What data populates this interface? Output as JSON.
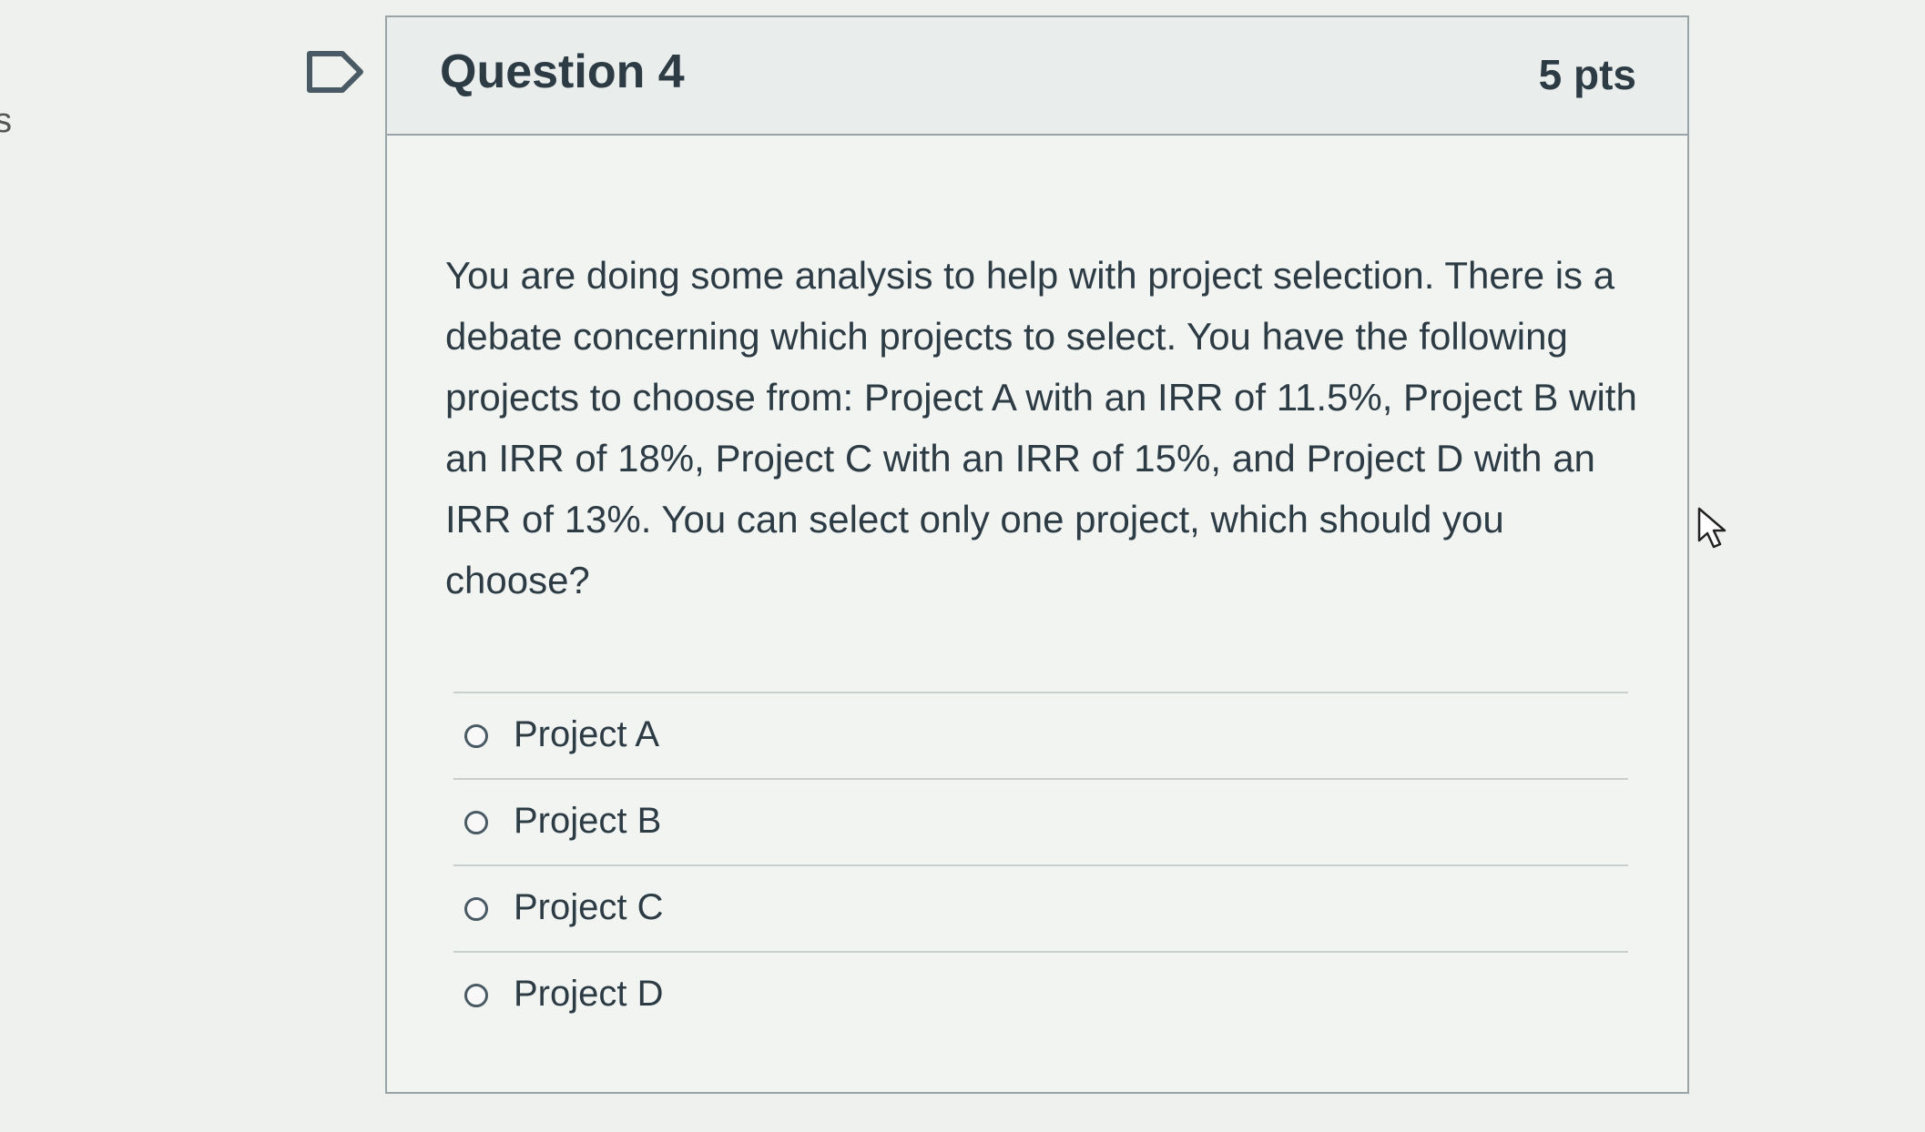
{
  "page": {
    "left_edge_text": "s"
  },
  "question": {
    "title": "Question 4",
    "points": "5 pts",
    "text": "You are doing some analysis to help with project selection. There is a debate concerning which projects to select. You have the following projects to choose from: Project A with an IRR of 11.5%, Project B with an IRR of 18%, Project C with an IRR of 15%, and Project D with an IRR of 13%. You can select only one project, which should you choose?",
    "answers": [
      {
        "label": "Project A",
        "selected": false
      },
      {
        "label": "Project B",
        "selected": false
      },
      {
        "label": "Project C",
        "selected": false
      },
      {
        "label": "Project D",
        "selected": false
      }
    ]
  },
  "icons": {
    "flag": "flag-icon",
    "cursor": "pointer-cursor-icon"
  },
  "colors": {
    "text": "#2d3b45",
    "border": "#9aa3a6",
    "background": "#eef1ee"
  }
}
